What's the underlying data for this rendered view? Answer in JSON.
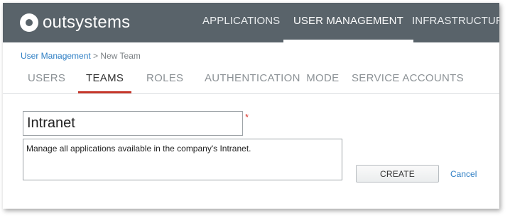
{
  "header": {
    "logo_text": "outsystems",
    "nav": [
      {
        "label": "APPLICATIONS",
        "active": false
      },
      {
        "label": "USER MANAGEMENT",
        "active": true
      },
      {
        "label": "INFRASTRUCTURE",
        "active": false
      }
    ]
  },
  "breadcrumb": {
    "parent": "User Management",
    "separator": " > ",
    "current": "New Team"
  },
  "tabs": [
    {
      "label": "USERS",
      "active": false
    },
    {
      "label": "TEAMS",
      "active": true
    },
    {
      "label": "ROLES",
      "active": false
    },
    {
      "label": "AUTHENTICATION MODE",
      "active": false
    },
    {
      "label": "SERVICE ACCOUNTS",
      "active": false
    }
  ],
  "form": {
    "name_value": "Intranet",
    "required_mark": "*",
    "description_value": "Manage all applications available in the company's Intranet.",
    "create_label": "CREATE",
    "cancel_label": "Cancel"
  },
  "colors": {
    "header_bg": "#59636a",
    "active_tab_underline": "#c6372b",
    "link": "#2d7ec4",
    "required": "#d9342b"
  },
  "icons": {
    "logo": "outsystems-logo-icon"
  }
}
